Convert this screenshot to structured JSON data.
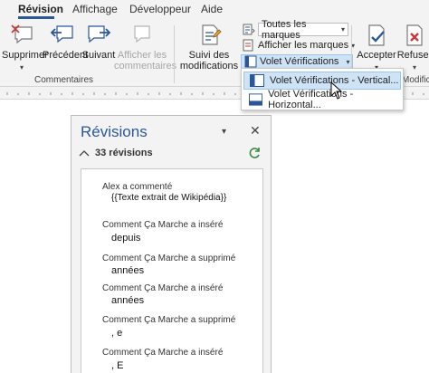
{
  "tabs": [
    {
      "label": "Révision",
      "active": true
    },
    {
      "label": "Affichage"
    },
    {
      "label": "Développeur"
    },
    {
      "label": "Aide"
    }
  ],
  "ribbon": {
    "comments": {
      "delete": "Supprimer",
      "previous": "Précédent",
      "next": "Suivant",
      "show_comments_line1": "Afficher les",
      "show_comments_line2": "commentaires",
      "group_label": "Commentaires"
    },
    "tracking": {
      "track_changes_line1": "Suivi des",
      "track_changes_line2": "modifications",
      "markup_select": "Toutes les marques",
      "show_markup": "Afficher les marques",
      "reviewing_pane": "Volet Vérifications",
      "group_label_partial": "Modifica"
    },
    "changes": {
      "accept": "Accepter",
      "reject": "Refuser"
    }
  },
  "dropdown_menu": {
    "items": [
      {
        "label": "Volet Vérifications - Vertical...",
        "highlighted": true
      },
      {
        "label": "Volet Vérifications - Horizontal..."
      }
    ]
  },
  "revisions_pane": {
    "title": "Révisions",
    "count_label": "33 révisions",
    "entries": [
      {
        "author": "Alex a commenté",
        "text": "{{Texte extrait de Wikipédia}}"
      },
      {
        "author": "Comment Ça Marche a inséré",
        "text": "depuis"
      },
      {
        "author": "Comment Ça Marche a supprimé",
        "text": "années"
      },
      {
        "author": "Comment Ça Marche a inséré",
        "text": "années"
      },
      {
        "author": "Comment Ça Marche a supprimé",
        "text": ", e"
      },
      {
        "author": "Comment Ça Marche a inséré",
        "text": ", E"
      }
    ]
  },
  "colors": {
    "accent": "#2b579a",
    "ribbon_bg": "#f3f3f3",
    "menu_highlight": "#cfe3f7",
    "refresh_green": "#3a8a3a",
    "reject_red": "#c43b3b"
  }
}
